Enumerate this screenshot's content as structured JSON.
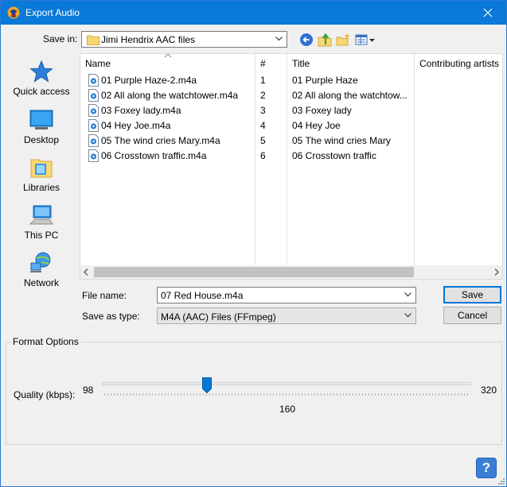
{
  "window": {
    "title": "Export Audio"
  },
  "save_in": {
    "label": "Save in:",
    "folder": "Jimi Hendrix AAC files"
  },
  "toolbar_icons": [
    "back-arrow-icon",
    "up-folder-icon",
    "new-folder-icon",
    "view-menu-icon"
  ],
  "places": [
    {
      "label": "Quick access",
      "icon": "star-icon"
    },
    {
      "label": "Desktop",
      "icon": "desktop-icon"
    },
    {
      "label": "Libraries",
      "icon": "libraries-icon"
    },
    {
      "label": "This PC",
      "icon": "computer-icon"
    },
    {
      "label": "Network",
      "icon": "network-icon"
    }
  ],
  "file_list": {
    "columns": [
      "Name",
      "#",
      "Title",
      "Contributing artists"
    ],
    "rows": [
      {
        "name": "01 Purple Haze-2.m4a",
        "num": "1",
        "title": "01 Purple Haze"
      },
      {
        "name": "02 All along the watchtower.m4a",
        "num": "2",
        "title": "02 All along the watchtow..."
      },
      {
        "name": "03 Foxey lady.m4a",
        "num": "3",
        "title": "03 Foxey lady"
      },
      {
        "name": "04 Hey Joe.m4a",
        "num": "4",
        "title": "04 Hey Joe"
      },
      {
        "name": "05 The wind cries Mary.m4a",
        "num": "5",
        "title": "05 The wind cries Mary"
      },
      {
        "name": "06 Crosstown traffic.m4a",
        "num": "6",
        "title": "06 Crosstown traffic"
      }
    ]
  },
  "file_name": {
    "label": "File name:",
    "value": "07 Red House.m4a"
  },
  "save_type": {
    "label": "Save as type:",
    "value": "M4A (AAC) Files (FFmpeg)"
  },
  "buttons": {
    "save": "Save",
    "cancel": "Cancel",
    "help": "?"
  },
  "format_options": {
    "title": "Format Options",
    "quality_label": "Quality (kbps):",
    "min": "98",
    "max": "320",
    "value": "160"
  },
  "colors": {
    "title_bar": "#0a79d7",
    "accent": "#0078d7"
  }
}
